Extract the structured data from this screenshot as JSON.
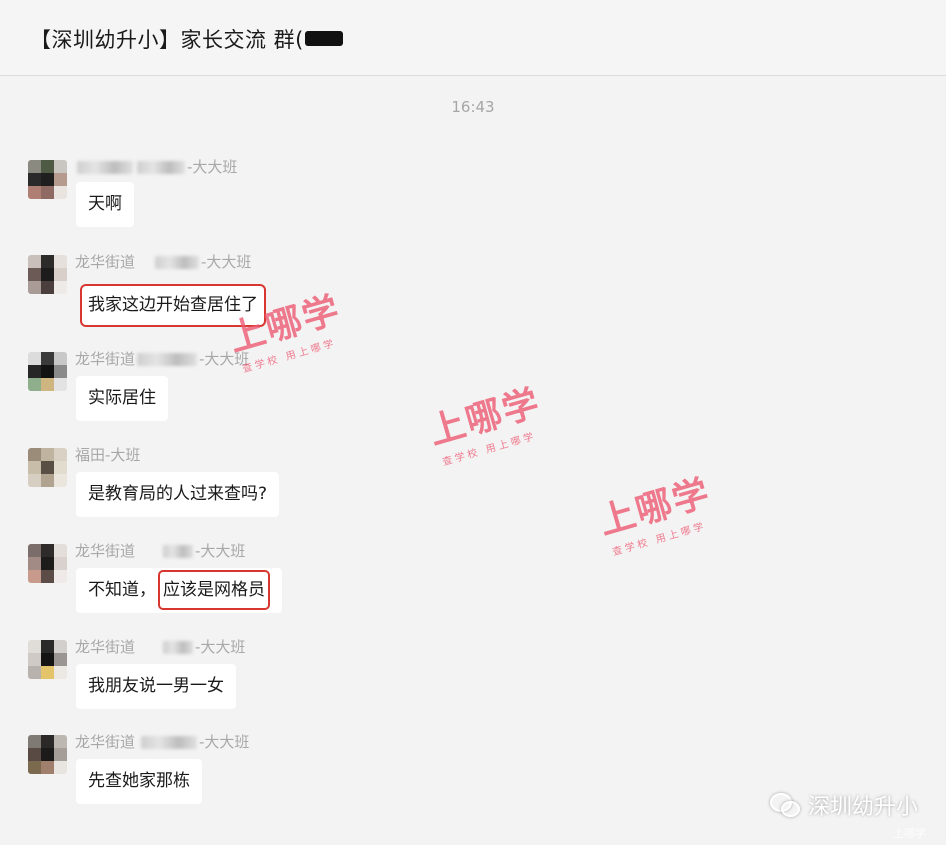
{
  "header": {
    "title": "【深圳幼升小】家长交流  群("
  },
  "timestamp": "16:43",
  "messages": [
    {
      "sender_prefix": "",
      "sender_suffix": "-大大班",
      "text": "天啊",
      "avatar_colors": [
        "#8a8a80",
        "#4f5a44",
        "#c9c5c0",
        "#2a2a2a",
        "#1f1f1f",
        "#b59a8e",
        "#b07f74",
        "#8f6a62",
        "#e9e4e0"
      ]
    },
    {
      "sender_prefix": "龙华街道",
      "sender_suffix": "-大大班",
      "text": "我家这边开始查居住了",
      "highlight": "full",
      "avatar_colors": [
        "#c9bfbb",
        "#2d2a2a",
        "#e6e0dd",
        "#6b5a55",
        "#1c1c1c",
        "#d8cfcb",
        "#a99b96",
        "#4a3f3c",
        "#eeeae7"
      ]
    },
    {
      "sender_prefix": "龙华街道",
      "sender_suffix": "-大大班",
      "text": "实际居住",
      "avatar_colors": [
        "#dcdcdc",
        "#3a3a3a",
        "#c8c8c8",
        "#262626",
        "#121212",
        "#8a8a8a",
        "#8fae8c",
        "#cfb580",
        "#e3e3e3"
      ]
    },
    {
      "sender_prefix": "福田-大班",
      "sender_suffix": "",
      "text": "是教育局的人过来查吗?",
      "avatar_colors": [
        "#9b8c7a",
        "#bfb49f",
        "#d9d2c4",
        "#c7bda8",
        "#5a4f44",
        "#e2dccf",
        "#d6cfc1",
        "#b0a490",
        "#ebe6dd"
      ]
    },
    {
      "sender_prefix": "龙华街道",
      "sender_suffix": "-大大班",
      "text_prefix": "不知道，",
      "text_highlight": "应该是网格员",
      "avatar_colors": [
        "#7b6e6a",
        "#2f2b2a",
        "#e4dedb",
        "#a38b85",
        "#1e1b1b",
        "#d9d1ce",
        "#c79a8c",
        "#5c4c48",
        "#efeae8"
      ]
    },
    {
      "sender_prefix": "龙华街道",
      "sender_suffix": "-大大班",
      "text": "我朋友说一男一女",
      "avatar_colors": [
        "#e0dcd8",
        "#2a2a2a",
        "#d3cfcc",
        "#cfcac6",
        "#141414",
        "#9a9592",
        "#b8b2af",
        "#e3c46a",
        "#ece8e4"
      ]
    },
    {
      "sender_prefix": "龙华街道",
      "sender_suffix": "-大大班",
      "text": "先查她家那栋",
      "avatar_colors": [
        "#7f7a74",
        "#2b2928",
        "#bdb7b2",
        "#5a4a44",
        "#1d1b1a",
        "#a49d98",
        "#7c6a4e",
        "#a07f6c",
        "#e8e4e0"
      ]
    }
  ],
  "watermark": {
    "big": "上哪学",
    "small": "查学校 用上哪学",
    "color": "#ee5a73"
  },
  "brand": {
    "name": "深圳幼升小",
    "sub": "上哪学",
    "icon": "wechat-icon"
  }
}
